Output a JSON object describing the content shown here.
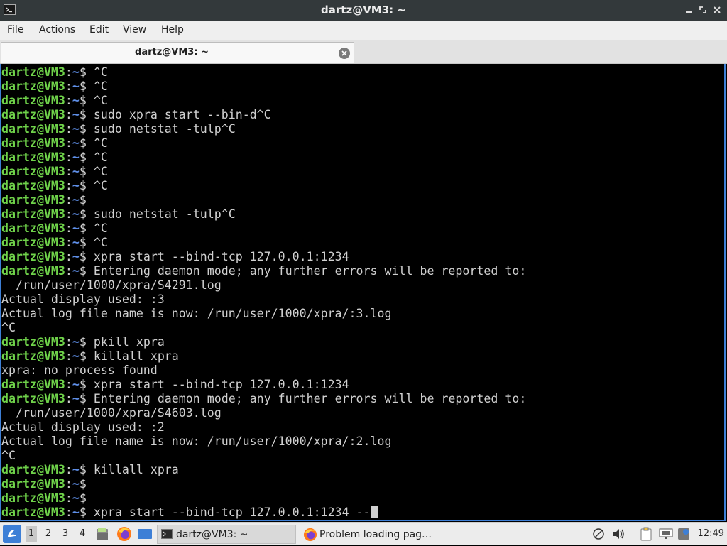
{
  "window": {
    "title": "dartz@VM3: ~",
    "controls": [
      "minimize",
      "maximize",
      "close"
    ]
  },
  "menu": [
    "File",
    "Actions",
    "Edit",
    "View",
    "Help"
  ],
  "tab": {
    "label": "dartz@VM3: ~"
  },
  "prompt": {
    "user": "dartz@VM3",
    "sep": ":",
    "path": "~",
    "symbol": "$ "
  },
  "terminal": {
    "lines": [
      {
        "p": true,
        "t": "^C"
      },
      {
        "p": true,
        "t": "^C"
      },
      {
        "p": true,
        "t": "^C"
      },
      {
        "p": true,
        "t": "sudo xpra start --bin-d^C"
      },
      {
        "p": true,
        "t": "sudo netstat -tulp^C"
      },
      {
        "p": true,
        "t": "^C"
      },
      {
        "p": true,
        "t": "^C"
      },
      {
        "p": true,
        "t": "^C"
      },
      {
        "p": true,
        "t": "^C"
      },
      {
        "p": true,
        "t": ""
      },
      {
        "p": true,
        "t": "sudo netstat -tulp^C"
      },
      {
        "p": true,
        "t": "^C"
      },
      {
        "p": true,
        "t": "^C"
      },
      {
        "p": true,
        "t": "xpra start --bind-tcp 127.0.0.1:1234"
      },
      {
        "p": true,
        "t": "Entering daemon mode; any further errors will be reported to:"
      },
      {
        "p": false,
        "t": "  /run/user/1000/xpra/S4291.log"
      },
      {
        "p": false,
        "t": "Actual display used: :3"
      },
      {
        "p": false,
        "t": "Actual log file name is now: /run/user/1000/xpra/:3.log"
      },
      {
        "p": false,
        "t": "^C"
      },
      {
        "p": true,
        "t": "pkill xpra"
      },
      {
        "p": true,
        "t": "killall xpra"
      },
      {
        "p": false,
        "t": "xpra: no process found"
      },
      {
        "p": true,
        "t": "xpra start --bind-tcp 127.0.0.1:1234"
      },
      {
        "p": true,
        "t": "Entering daemon mode; any further errors will be reported to:"
      },
      {
        "p": false,
        "t": "  /run/user/1000/xpra/S4603.log"
      },
      {
        "p": false,
        "t": "Actual display used: :2"
      },
      {
        "p": false,
        "t": "Actual log file name is now: /run/user/1000/xpra/:2.log"
      },
      {
        "p": false,
        "t": "^C"
      },
      {
        "p": true,
        "t": "killall xpra"
      },
      {
        "p": true,
        "t": ""
      },
      {
        "p": true,
        "t": ""
      },
      {
        "p": true,
        "t": "xpra start --bind-tcp 127.0.0.1:1234 --",
        "cursor": true
      }
    ]
  },
  "taskbar": {
    "workspaces": [
      "1",
      "2",
      "3",
      "4"
    ],
    "active_workspace": "1",
    "tasks": [
      {
        "label": "dartz@VM3: ~",
        "icon": "terminal-icon",
        "active": true
      },
      {
        "label": "Problem loading pag…",
        "icon": "firefox-icon",
        "active": false
      }
    ],
    "clock": "12:49"
  },
  "colors": {
    "prompt_user": "#6fd24a",
    "prompt_path": "#5f8fe8",
    "focus_border": "#3d7fd6",
    "titlebar": "#33393b"
  }
}
